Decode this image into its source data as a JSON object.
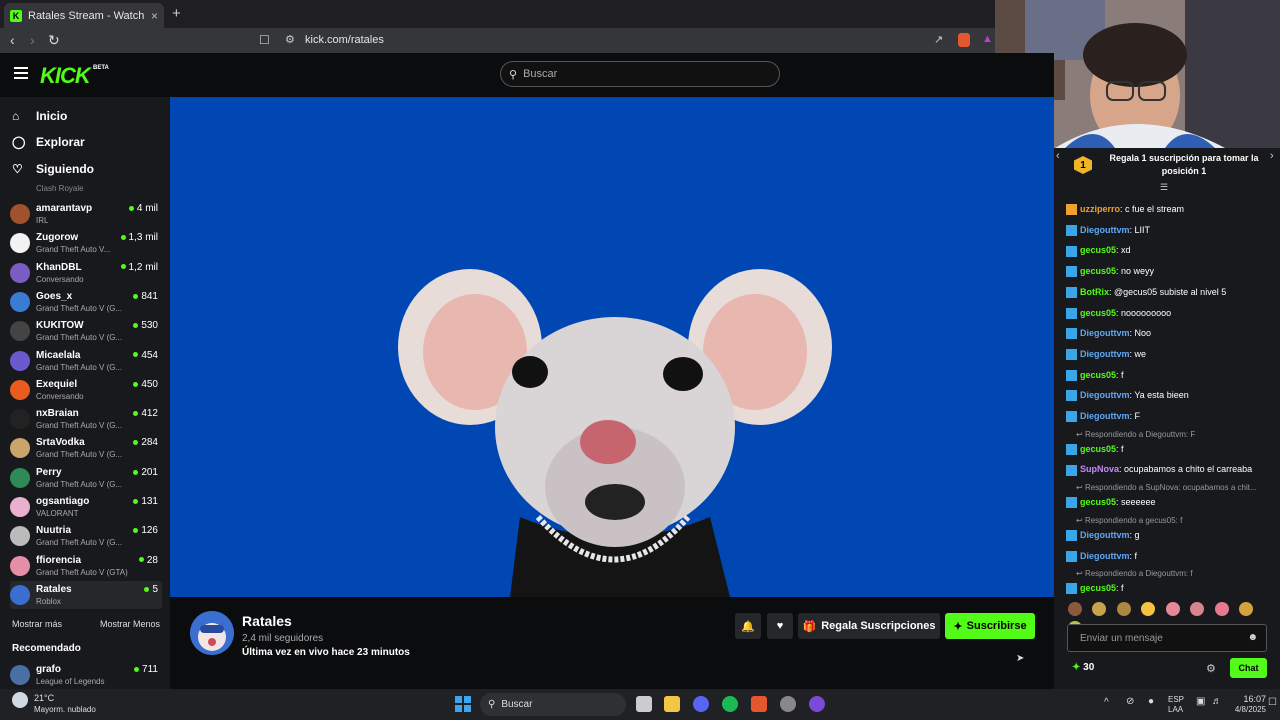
{
  "browser": {
    "tab_title": "Ratales Stream - Watch Live on K",
    "tab_close": "×",
    "new_tab": "+",
    "url": "kick.com/ratales",
    "favicon": "K"
  },
  "header": {
    "logo": "KICK",
    "beta": "BETA",
    "search_placeholder": "Buscar"
  },
  "sidebar": {
    "nav": [
      {
        "label": "Inicio",
        "icon": "home-icon"
      },
      {
        "label": "Explorar",
        "icon": "compass-icon"
      },
      {
        "label": "Siguiendo",
        "icon": "heart-icon"
      }
    ],
    "partial_category": "Clash Royale",
    "channels": [
      {
        "name": "amarantavp",
        "game": "IRL",
        "viewers": "4 mil",
        "color": "#a0522d"
      },
      {
        "name": "Zugorow",
        "game": "Grand Theft Auto V...",
        "viewers": "1,3 mil",
        "color": "#f2f2f2"
      },
      {
        "name": "KhanDBL",
        "game": "Conversando",
        "viewers": "1,2 mil",
        "color": "#7b5cc2"
      },
      {
        "name": "Goes_x",
        "game": "Grand Theft Auto V (G...",
        "viewers": "841",
        "color": "#3a7bd5"
      },
      {
        "name": "KUKITOW",
        "game": "Grand Theft Auto V (G...",
        "viewers": "530",
        "color": "#444"
      },
      {
        "name": "Micaelala",
        "game": "Grand Theft Auto V (G...",
        "viewers": "454",
        "color": "#6a5acd"
      },
      {
        "name": "Exequiel",
        "game": "Conversando",
        "viewers": "450",
        "color": "#e85d1f"
      },
      {
        "name": "nxBraian",
        "game": "Grand Theft Auto V (G...",
        "viewers": "412",
        "color": "#222"
      },
      {
        "name": "SrtaVodka",
        "game": "Grand Theft Auto V (G...",
        "viewers": "284",
        "color": "#c9a46b"
      },
      {
        "name": "Perry",
        "game": "Grand Theft Auto V (G...",
        "viewers": "201",
        "color": "#2e8b57"
      },
      {
        "name": "ogsantiago",
        "game": "VALORANT",
        "viewers": "131",
        "color": "#e9b0d0"
      },
      {
        "name": "Nuutria",
        "game": "Grand Theft Auto V (G...",
        "viewers": "126",
        "color": "#bbb"
      },
      {
        "name": "ffiorencia",
        "game": "Grand Theft Auto V (GTA)",
        "viewers": "28",
        "color": "#e58fa6"
      },
      {
        "name": "Ratales",
        "game": "Roblox",
        "viewers": "5",
        "color": "#3a6fd1"
      }
    ],
    "show_more": "Mostrar más",
    "show_less": "Mostrar Menos",
    "recommended": "Recomendado",
    "recommended_channel": {
      "name": "grafo",
      "game": "League of Legends",
      "viewers": "711",
      "color": "#4a6fa5"
    }
  },
  "streamer": {
    "name": "Ratales",
    "followers": "2,4 mil seguidores",
    "last_live": "Última vez en vivo hace 23 minutos",
    "gift_subs": "Regala Suscripciones",
    "subscribe": "Suscribirse"
  },
  "chat": {
    "pinned_rank": "1",
    "pinned_text": "Regala 1 suscripción para tomar la posición 1",
    "messages": [
      {
        "type": "msg",
        "user": "uzziperro",
        "text": ": c fue el stream",
        "color": "#f0a030",
        "badge": "#f0a030"
      },
      {
        "type": "msg",
        "user": "Diegouttvm",
        "text": ": LIIT",
        "color": "#5fa8f5",
        "badge": "#3aa6e8"
      },
      {
        "type": "msg",
        "user": "gecus05",
        "text": ": xd",
        "color": "#53fc18",
        "badge": "#3aa6e8"
      },
      {
        "type": "msg",
        "user": "gecus05",
        "text": ": no weyy",
        "color": "#53fc18",
        "badge": "#3aa6e8"
      },
      {
        "type": "msg",
        "user": "BotRix",
        "text": ": @gecus05 subiste al nivel 5",
        "color": "#53fc18",
        "badge": "#3aa6e8"
      },
      {
        "type": "msg",
        "user": "gecus05",
        "text": ": nooooooooo",
        "color": "#53fc18",
        "badge": "#3aa6e8"
      },
      {
        "type": "msg",
        "user": "Diegouttvm",
        "text": ": Noo",
        "color": "#5fa8f5",
        "badge": "#3aa6e8"
      },
      {
        "type": "msg",
        "user": "Diegouttvm",
        "text": ": we",
        "color": "#5fa8f5",
        "badge": "#3aa6e8"
      },
      {
        "type": "msg",
        "user": "gecus05",
        "text": ": f",
        "color": "#53fc18",
        "badge": "#3aa6e8"
      },
      {
        "type": "msg",
        "user": "Diegouttvm",
        "text": ": Ya esta bieen",
        "color": "#5fa8f5",
        "badge": "#3aa6e8"
      },
      {
        "type": "msg",
        "user": "Diegouttvm",
        "text": ": F",
        "color": "#5fa8f5",
        "badge": "#3aa6e8"
      },
      {
        "type": "reply",
        "text": "Respondiendo a Diegouttvm: F"
      },
      {
        "type": "msg",
        "user": "gecus05",
        "text": ": f",
        "color": "#53fc18",
        "badge": "#3aa6e8"
      },
      {
        "type": "msg",
        "user": "SupNova",
        "text": ": ocupabamos a chito el carreaba",
        "color": "#c58af9",
        "badge": "#3aa6e8"
      },
      {
        "type": "reply",
        "text": "Respondiendo a SupNova: ocupabamos a chit..."
      },
      {
        "type": "msg",
        "user": "gecus05",
        "text": ": seeeeee",
        "color": "#53fc18",
        "badge": "#3aa6e8"
      },
      {
        "type": "reply",
        "text": "Respondiendo a gecus05: f"
      },
      {
        "type": "msg",
        "user": "Diegouttvm",
        "text": ": g",
        "color": "#5fa8f5",
        "badge": "#3aa6e8"
      },
      {
        "type": "msg",
        "user": "Diegouttvm",
        "text": ": f",
        "color": "#5fa8f5",
        "badge": "#3aa6e8"
      },
      {
        "type": "reply",
        "text": "Respondiendo a Diegouttvm: f"
      },
      {
        "type": "msg",
        "user": "gecus05",
        "text": ": f",
        "color": "#53fc18",
        "badge": "#3aa6e8"
      }
    ],
    "input_placeholder": "Enviar un mensaje",
    "points": "30",
    "chat_button": "Chat"
  },
  "taskbar": {
    "temp": "21°C",
    "condition": "Mayorm. nublado",
    "search": "Buscar",
    "lang1": "ESP",
    "lang2": "LAA",
    "time": "16:07",
    "date": "4/8/2025"
  },
  "colors": {
    "accent": "#53fc18",
    "video_bg": "#0047b3"
  }
}
